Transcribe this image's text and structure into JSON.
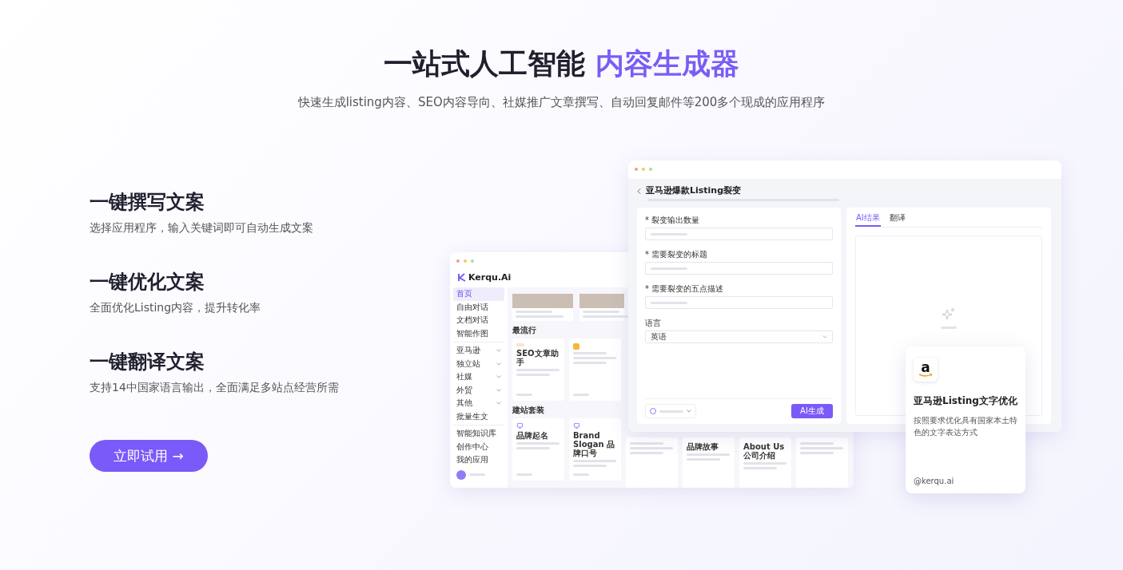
{
  "header": {
    "title": "一站式人工智能",
    "title_highlight": "内容生成器",
    "subtitle": "快速生成listing内容、SEO内容导向、社媒推广文章撰写、自动回复邮件等200多个现成的应用程序"
  },
  "features": [
    {
      "title": "一键撰写文案",
      "description": "选择应用程序，输入关键词即可自动生成文案"
    },
    {
      "title": "一键优化文案",
      "description": "全面优化Listing内容，提升转化率"
    },
    {
      "title": "一键翻译文案",
      "description": "支持14中国家语言输出，全面满足多站点经营所需"
    }
  ],
  "cta": {
    "label": "立即试用 →"
  },
  "app_window": {
    "logo": "Kerqu.Ai",
    "sidebar": {
      "groups": [
        {
          "items": [
            {
              "label": "首页",
              "selected": true,
              "has_submenu": false
            },
            {
              "label": "自由对话",
              "selected": false,
              "has_submenu": false
            },
            {
              "label": "文档对话",
              "selected": false,
              "has_submenu": false
            },
            {
              "label": "智能作图",
              "selected": false,
              "has_submenu": false
            }
          ]
        },
        {
          "items": [
            {
              "label": "亚马逊",
              "selected": false,
              "has_submenu": true
            },
            {
              "label": "独立站",
              "selected": false,
              "has_submenu": true
            },
            {
              "label": "社媒",
              "selected": false,
              "has_submenu": true
            },
            {
              "label": "外贸",
              "selected": false,
              "has_submenu": true
            },
            {
              "label": "其他",
              "selected": false,
              "has_submenu": true
            },
            {
              "label": "批量生文",
              "selected": false,
              "has_submenu": false
            }
          ]
        },
        {
          "items": [
            {
              "label": "智能知识库",
              "selected": false,
              "has_submenu": false
            },
            {
              "label": "创作中心",
              "selected": false,
              "has_submenu": false
            },
            {
              "label": "我的应用",
              "selected": false,
              "has_submenu": false
            }
          ]
        }
      ]
    },
    "sections": [
      {
        "title": "最流行",
        "cards": [
          {
            "title": "SEO文章助手",
            "kind": "tag"
          },
          {
            "kind": "square"
          }
        ]
      },
      {
        "title": "建站套装",
        "cards": [
          {
            "title": "品牌起名",
            "kind": "site"
          },
          {
            "title": "Brand Slogan 品牌口号",
            "kind": "site"
          },
          {
            "kind": "plain"
          },
          {
            "title": "品牌故事",
            "kind": "plain"
          },
          {
            "title": "About Us公司介绍",
            "kind": "plain"
          },
          {
            "kind": "plain"
          }
        ]
      }
    ]
  },
  "form_window": {
    "title": "亚马逊爆款Listing裂变",
    "fields": [
      {
        "label": "* 裂变输出数量",
        "kind": "input"
      },
      {
        "label": "* 需要裂变的标题",
        "kind": "input"
      },
      {
        "label": "* 需要裂变的五点描述",
        "kind": "input"
      },
      {
        "label": "语言",
        "kind": "select",
        "value": "英语"
      }
    ],
    "submit": "AI生成",
    "result_tabs": [
      {
        "label": "AI结果",
        "selected": true
      },
      {
        "label": "翻译",
        "selected": false
      }
    ]
  },
  "feature_card": {
    "logo_letter": "a",
    "title": "亚马逊Listing文字优化",
    "description": "按照要求优化具有国家本土特色的文字表达方式",
    "footer": "@kerqu.ai"
  }
}
